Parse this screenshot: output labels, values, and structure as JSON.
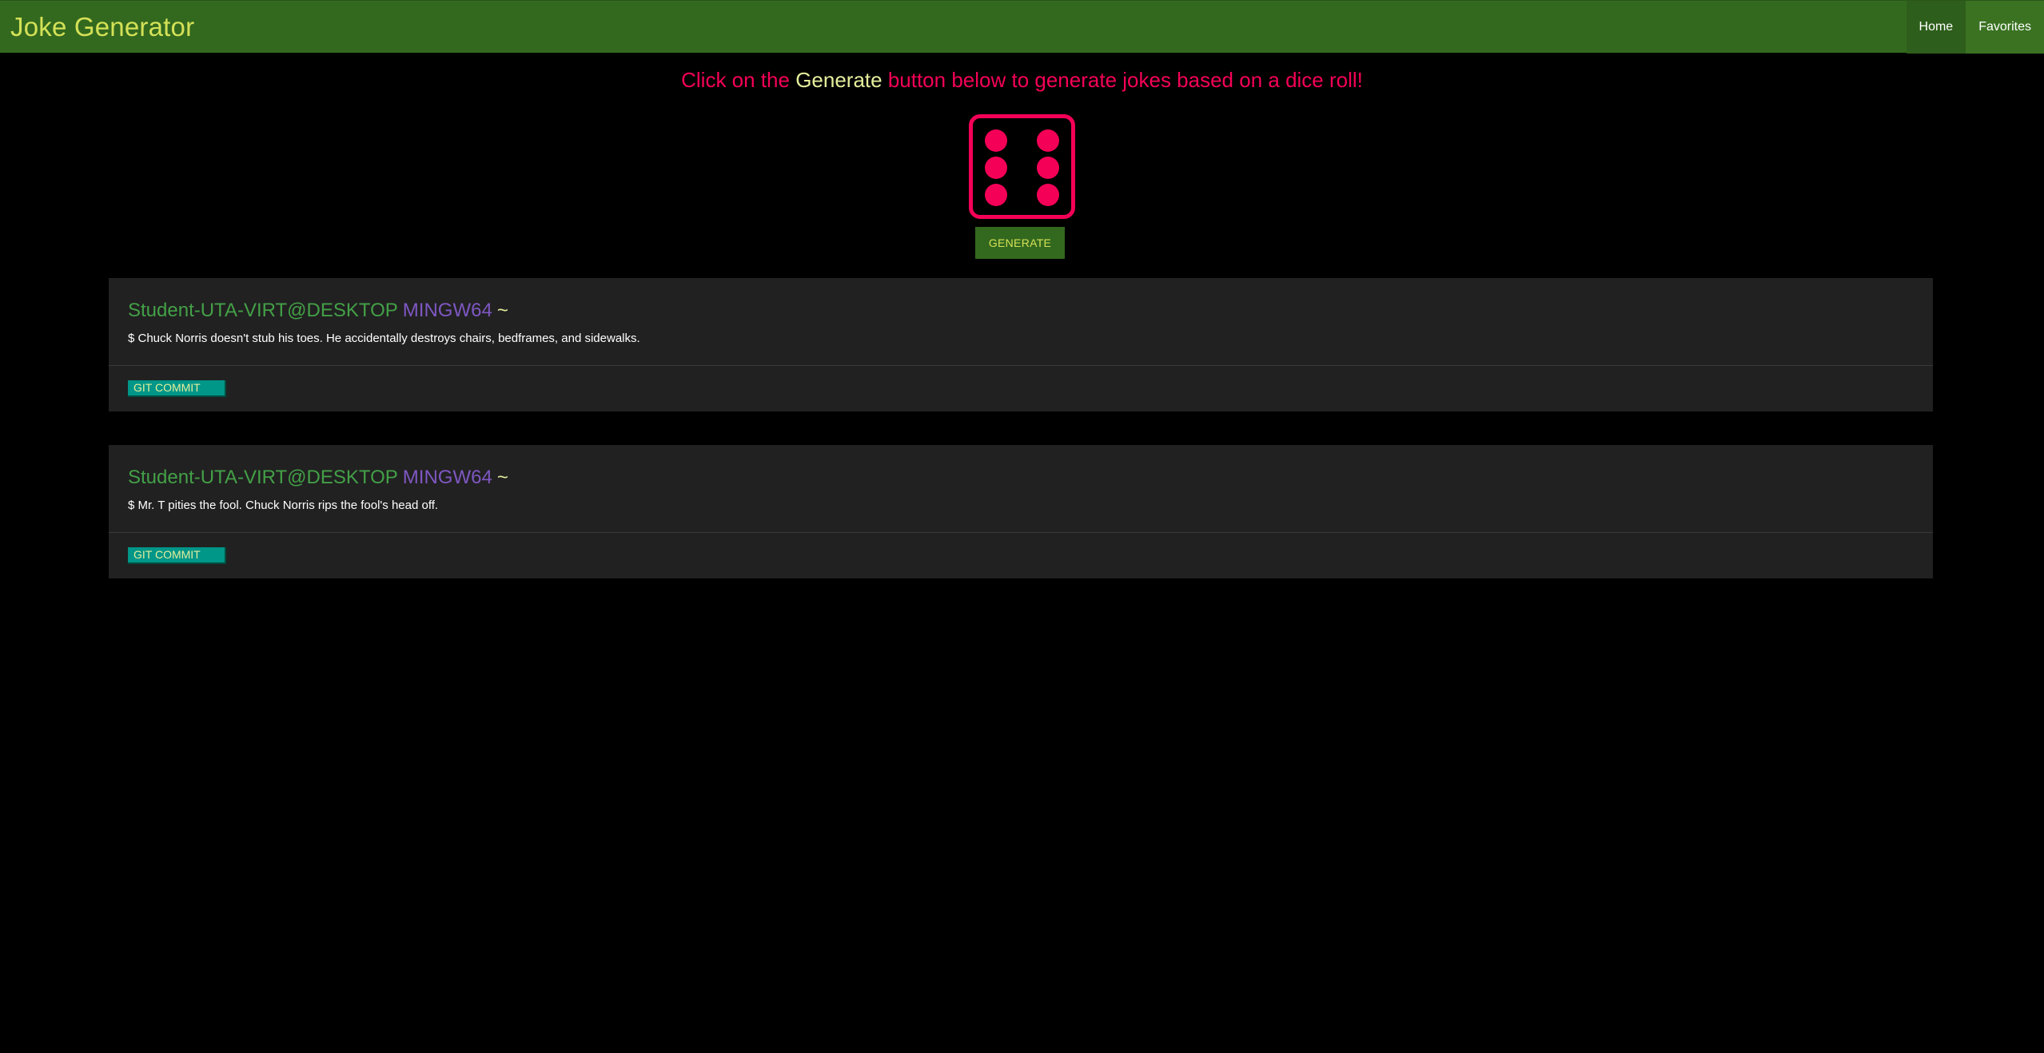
{
  "app": {
    "brand": "Joke Generator"
  },
  "nav": {
    "items": [
      {
        "label": "Home"
      },
      {
        "label": "Favorites"
      }
    ]
  },
  "headline": {
    "before": "Click on the ",
    "highlight": "Generate",
    "after": " button below to generate jokes based on a dice roll!"
  },
  "dice": {
    "value": 6,
    "icon": "dice-six-icon"
  },
  "generate_button": {
    "label": "GENERATE"
  },
  "jokes": [
    {
      "user": "Student-UTA-VIRT@DESKTOP",
      "host": "MINGW64",
      "tilde": "~",
      "text": "$ Chuck Norris doesn't stub his toes. He accidentally destroys chairs, bedframes, and sidewalks.",
      "action_label": "GIT COMMIT"
    },
    {
      "user": "Student-UTA-VIRT@DESKTOP",
      "host": "MINGW64",
      "tilde": "~",
      "text": "$ Mr. T pities the fool. Chuck Norris rips the fool's head off.",
      "action_label": "GIT COMMIT"
    }
  ],
  "colors": {
    "navbar": "#33691e",
    "brand_text": "#d4e157",
    "accent_pink": "#f50057",
    "highlight": "#e6ee9c",
    "card_bg": "#212121",
    "prompt_user": "#43a047",
    "prompt_host": "#7e57c2",
    "commit_button": "#009688"
  }
}
